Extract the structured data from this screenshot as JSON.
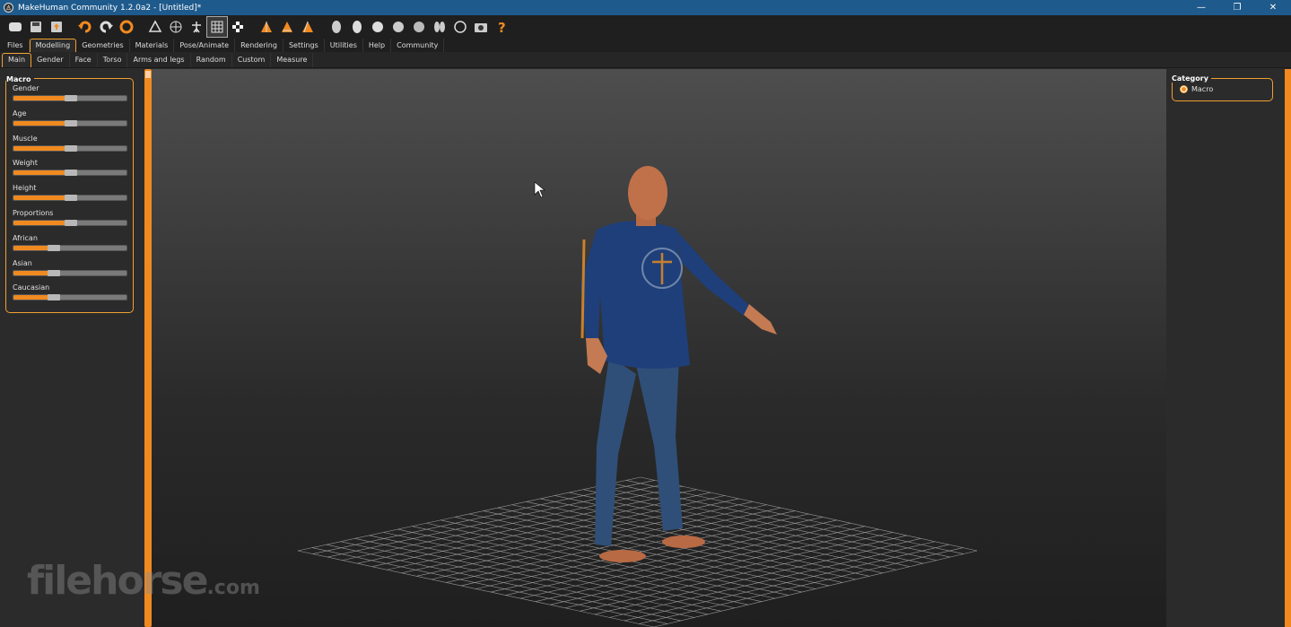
{
  "window": {
    "title": "MakeHuman Community 1.2.0a2 - [Untitled]*",
    "controls": [
      "—",
      "❐",
      "✕"
    ]
  },
  "toolbar": {
    "icons": [
      "smooth-icon",
      "save-icon",
      "export-icon",
      "undo-icon",
      "redo-icon",
      "reset-icon",
      "pose-icon",
      "wireframe-icon",
      "skeleton-icon",
      "grid-icon",
      "checker-icon",
      "front-view-icon",
      "back-view-icon",
      "side-view-icon",
      "head-front-icon",
      "head-side-icon",
      "head-top-icon",
      "head-back-icon",
      "head-bottom-icon",
      "body-icon",
      "reset-camera-icon",
      "screenshot-icon",
      "help-icon"
    ]
  },
  "main_tabs": [
    "Files",
    "Modelling",
    "Geometries",
    "Materials",
    "Pose/Animate",
    "Rendering",
    "Settings",
    "Utilities",
    "Help",
    "Community"
  ],
  "main_tabs_active": "Modelling",
  "sub_tabs": [
    "Main",
    "Gender",
    "Face",
    "Torso",
    "Arms and legs",
    "Random",
    "Custom",
    "Measure"
  ],
  "sub_tabs_active": "Main",
  "macro": {
    "title": "Macro",
    "sliders": [
      {
        "label": "Gender",
        "value": 0.5
      },
      {
        "label": "Age",
        "value": 0.5
      },
      {
        "label": "Muscle",
        "value": 0.5
      },
      {
        "label": "Weight",
        "value": 0.5
      },
      {
        "label": "Height",
        "value": 0.5
      },
      {
        "label": "Proportions",
        "value": 0.5
      },
      {
        "label": "African",
        "value": 0.333
      },
      {
        "label": "Asian",
        "value": 0.333
      },
      {
        "label": "Caucasian",
        "value": 0.333
      }
    ]
  },
  "category": {
    "title": "Category",
    "options": [
      "Macro"
    ],
    "selected": "Macro"
  },
  "watermark": {
    "brand": "filehorse",
    "suffix": ".com"
  },
  "colors": {
    "accent": "#f08a20",
    "titlebar": "#1e5a8c"
  }
}
